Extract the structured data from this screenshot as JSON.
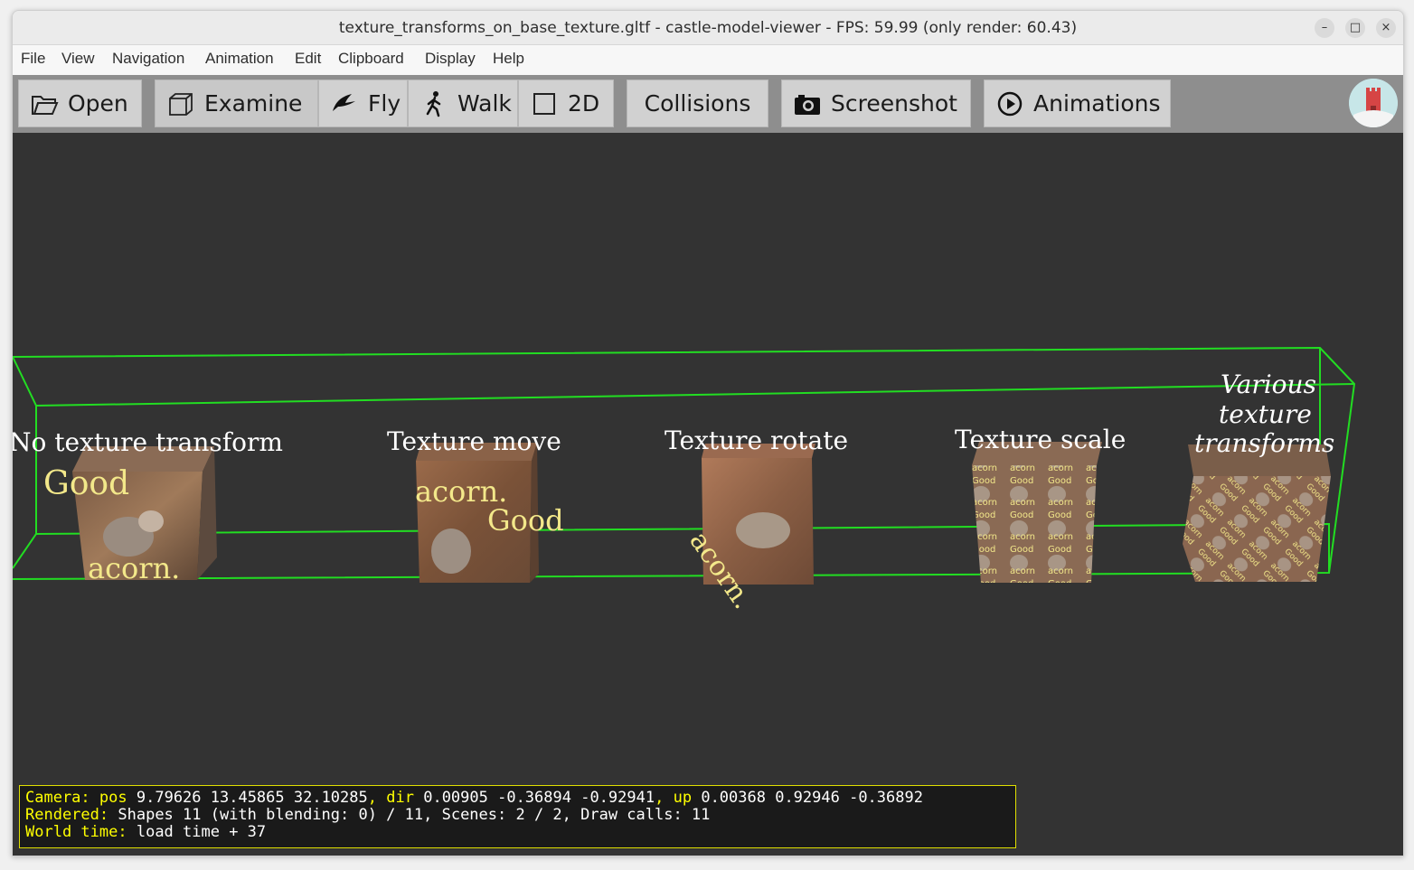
{
  "window": {
    "title": "texture_transforms_on_base_texture.gltf - castle-model-viewer - FPS: 59.99 (only render: 60.43)",
    "controls": {
      "minimize": "–",
      "maximize": "□",
      "close": "×"
    }
  },
  "menu": [
    "File",
    "View",
    "Navigation",
    "Animation",
    "Edit",
    "Clipboard",
    "Display",
    "Help"
  ],
  "toolbar": {
    "open": "Open",
    "examine": "Examine",
    "fly": "Fly",
    "walk": "Walk",
    "two_d": "2D",
    "collisions": "Collisions",
    "screenshot": "Screenshot",
    "animations": "Animations"
  },
  "scene": {
    "labels": [
      "No texture transform",
      "Texture move",
      "Texture rotate",
      "Texture scale"
    ],
    "last_label": [
      "Various",
      "texture",
      "transforms"
    ],
    "bbox_color": "#22dd22",
    "cube_texts": {
      "good": "Good",
      "acorn": "acorn."
    }
  },
  "status": {
    "camera_key": "Camera:",
    "pos_key": "pos",
    "pos_val": "9.79626 13.45865 32.10285",
    "dir_key": "dir",
    "dir_val": "0.00905 -0.36894 -0.92941",
    "up_key": "up",
    "up_val": "0.00368 0.92946 -0.36892",
    "rendered_key": "Rendered:",
    "rendered_val": "Shapes 11 (with blending: 0) / 11, Scenes: 2 / 2, Draw calls: 11",
    "world_key": "World time:",
    "world_val": "load time + 37"
  }
}
